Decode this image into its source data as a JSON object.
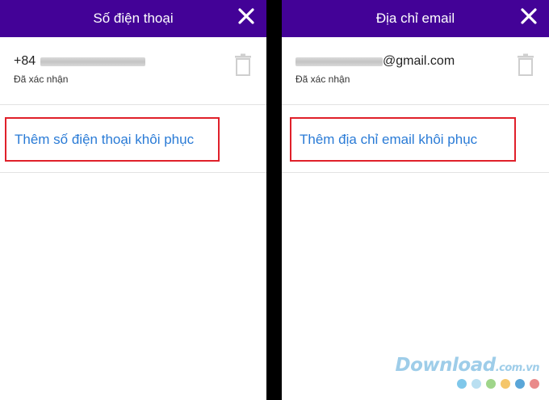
{
  "phone_panel": {
    "title": "Số điện thoại",
    "phone_prefix": "+84",
    "status": "Đã xác nhận",
    "add_label": "Thêm số điện thoại khôi phục"
  },
  "email_panel": {
    "title": "Địa chỉ email",
    "email_suffix": "@gmail.com",
    "status": "Đã xác nhận",
    "add_label": "Thêm địa chỉ email khôi phục"
  },
  "watermark": {
    "brand": "Download",
    "domain": ".com.vn",
    "dot_colors": [
      "#7fc7ea",
      "#b9dff1",
      "#9fd58a",
      "#f5c66a",
      "#5aa6d8",
      "#e98a8a"
    ]
  },
  "colors": {
    "header": "#430297",
    "link": "#2a7bd6",
    "highlight": "#e0202a"
  },
  "icons": [
    "close-icon",
    "trash-icon"
  ]
}
